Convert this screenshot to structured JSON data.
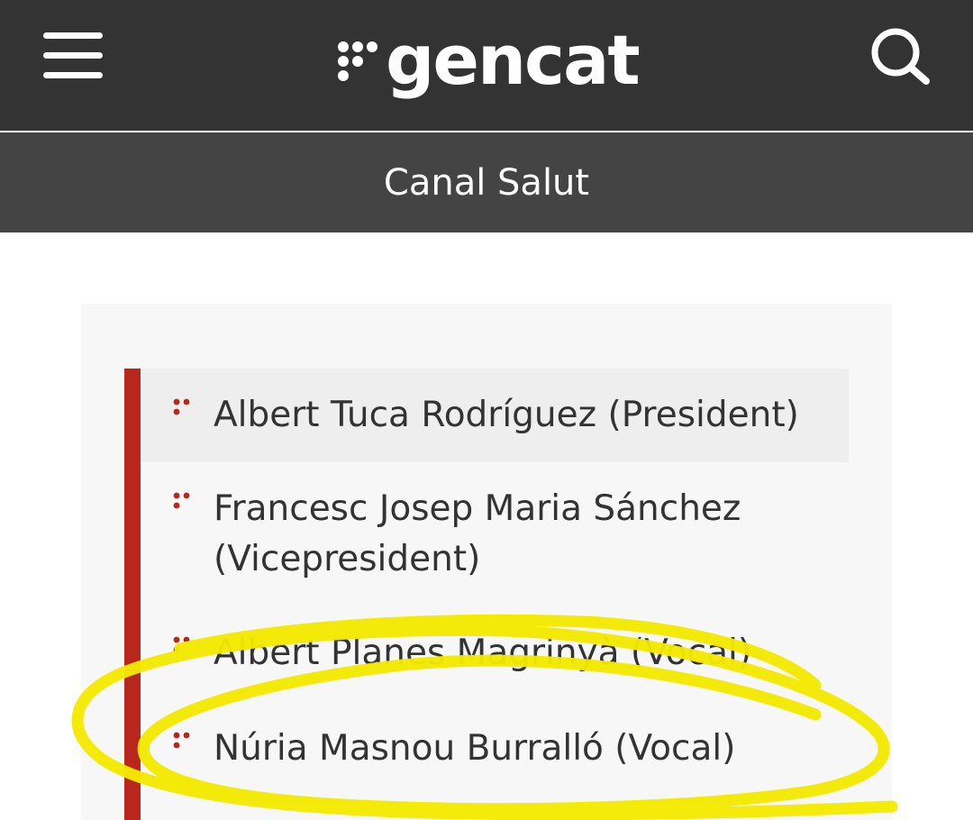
{
  "header": {
    "logo_text": "gencat",
    "menu_icon": "hamburger-menu-icon",
    "search_icon": "search-icon"
  },
  "section": {
    "title": "Canal Salut"
  },
  "members": [
    {
      "label": "Albert Tuca Rodríguez (President)",
      "active": true
    },
    {
      "label": "Francesc Josep Maria Sánchez (Vicepresident)",
      "active": false
    },
    {
      "label": "Albert Planes Magrinyà (Vocal)",
      "active": false
    },
    {
      "label": "Núria Masnou Burralló (Vocal)",
      "active": false
    }
  ],
  "colors": {
    "header_bg": "#333333",
    "subheader_bg": "#444444",
    "accent_red": "#b8261c",
    "highlight_yellow": "#f4ea00"
  }
}
